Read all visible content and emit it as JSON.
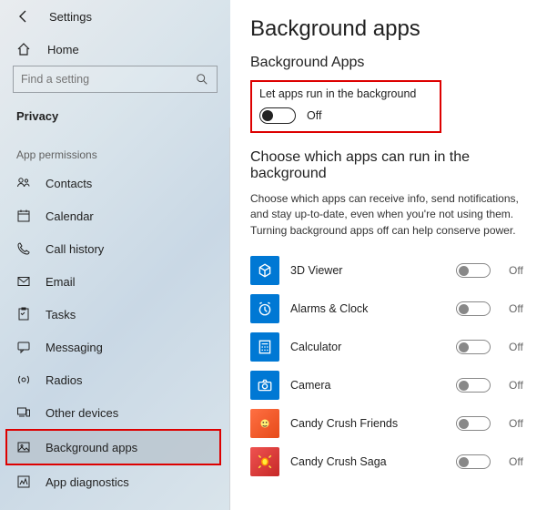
{
  "header": {
    "title": "Settings"
  },
  "home_label": "Home",
  "search": {
    "placeholder": "Find a setting"
  },
  "section": "Privacy",
  "subsection": "App permissions",
  "nav": [
    {
      "label": "Contacts",
      "icon": "contacts-icon"
    },
    {
      "label": "Calendar",
      "icon": "calendar-icon"
    },
    {
      "label": "Call history",
      "icon": "phone-icon"
    },
    {
      "label": "Email",
      "icon": "mail-icon"
    },
    {
      "label": "Tasks",
      "icon": "tasks-icon"
    },
    {
      "label": "Messaging",
      "icon": "message-icon"
    },
    {
      "label": "Radios",
      "icon": "radio-icon"
    },
    {
      "label": "Other devices",
      "icon": "devices-icon"
    },
    {
      "label": "Background apps",
      "icon": "image-icon"
    },
    {
      "label": "App diagnostics",
      "icon": "diagnostics-icon"
    }
  ],
  "main": {
    "title": "Background apps",
    "section1_title": "Background Apps",
    "master_toggle_label": "Let apps run in the background",
    "master_toggle_state": "Off",
    "section2_title": "Choose which apps can run in the background",
    "description": "Choose which apps can receive info, send notifications, and stay up-to-date, even when you're not using them. Turning background apps off can help conserve power.",
    "apps": [
      {
        "name": "3D Viewer",
        "state": "Off",
        "color": "blue"
      },
      {
        "name": "Alarms & Clock",
        "state": "Off",
        "color": "blue"
      },
      {
        "name": "Calculator",
        "state": "Off",
        "color": "blue"
      },
      {
        "name": "Camera",
        "state": "Off",
        "color": "blue"
      },
      {
        "name": "Candy Crush Friends",
        "state": "Off",
        "color": "orange"
      },
      {
        "name": "Candy Crush Saga",
        "state": "Off",
        "color": "red"
      }
    ]
  }
}
